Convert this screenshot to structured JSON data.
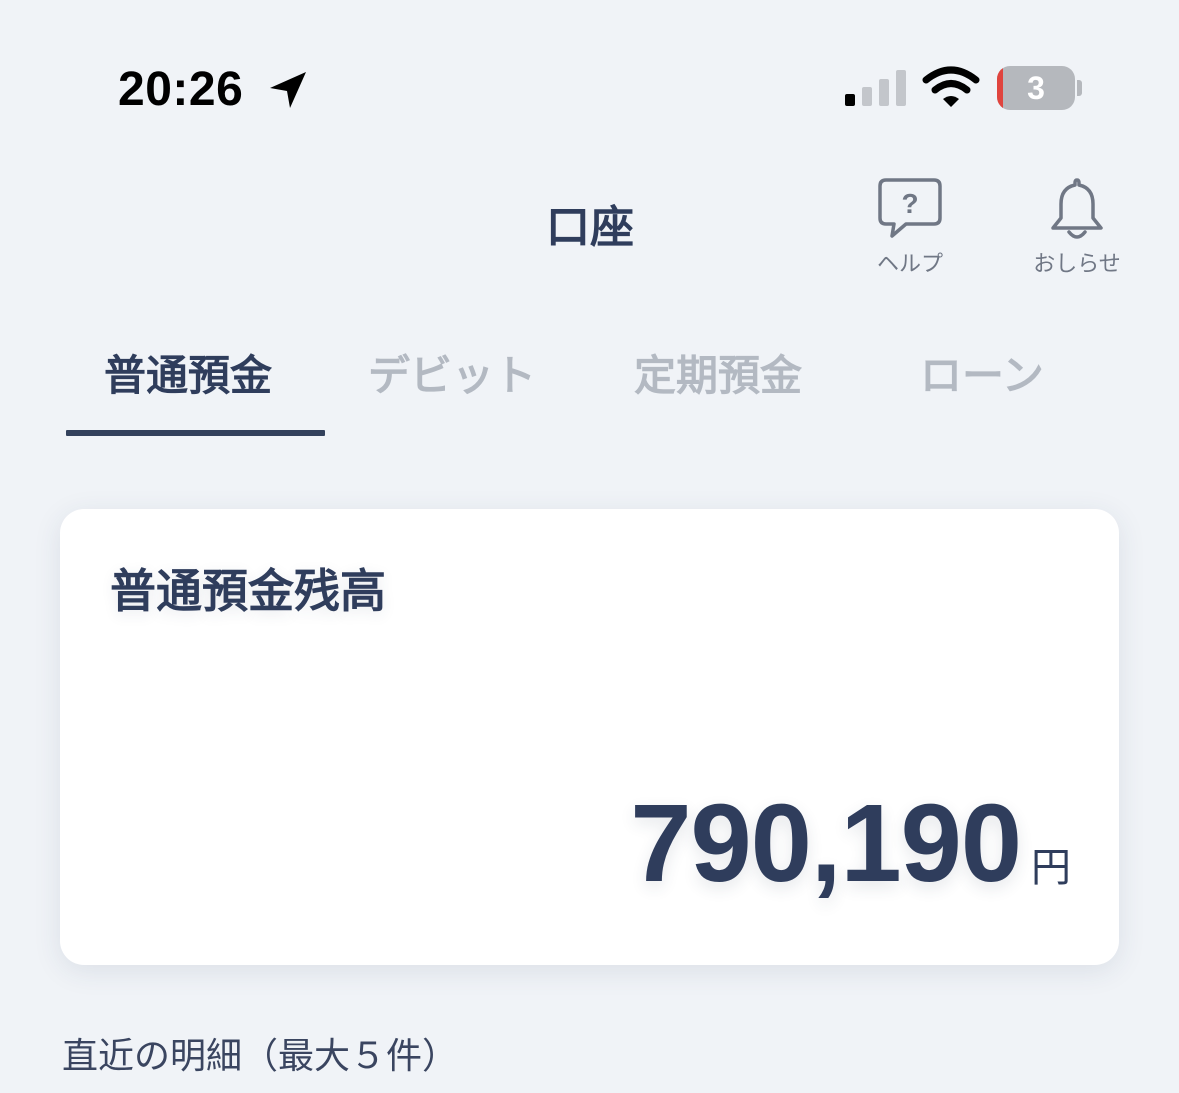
{
  "status_bar": {
    "time": "20:26",
    "battery_level": "3",
    "icons": [
      "location-arrow-icon",
      "cellular-signal-icon",
      "wifi-icon",
      "battery-icon"
    ]
  },
  "header": {
    "title": "口座",
    "help": {
      "label": "ヘルプ",
      "icon": "help-bubble-icon"
    },
    "notice": {
      "label": "おしらせ",
      "icon": "bell-icon"
    }
  },
  "tabs": [
    {
      "label": "普通預金",
      "active": true
    },
    {
      "label": "デビット",
      "active": false
    },
    {
      "label": "定期預金",
      "active": false
    },
    {
      "label": "ローン",
      "active": false
    }
  ],
  "balance_card": {
    "title": "普通預金残高",
    "amount": "790,190",
    "unit": "円"
  },
  "recent": {
    "heading": "直近の明細（最大５件）"
  },
  "colors": {
    "background": "#f0f3f7",
    "primary_text": "#2f3d5c",
    "inactive_tab": "#b3b9c2",
    "battery_low": "#e0443e",
    "card": "#ffffff"
  }
}
